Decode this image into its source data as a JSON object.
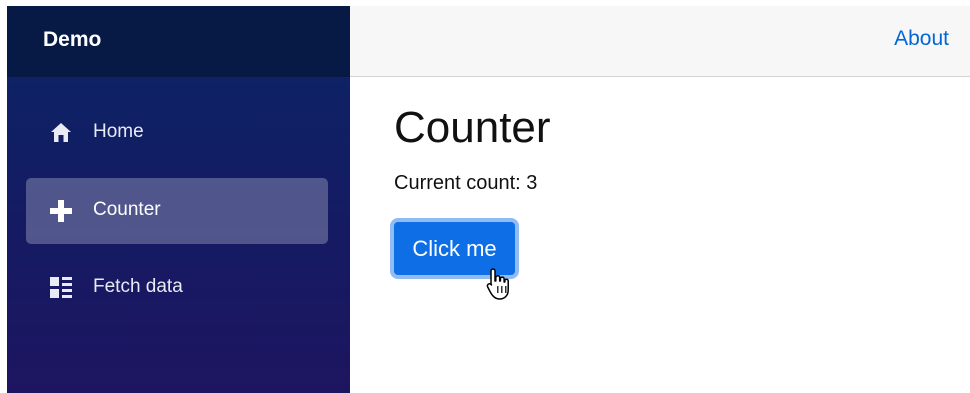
{
  "sidebar": {
    "brand": "Demo",
    "items": [
      {
        "label": "Home",
        "icon": "home-icon",
        "active": false
      },
      {
        "label": "Counter",
        "icon": "plus-icon",
        "active": true
      },
      {
        "label": "Fetch data",
        "icon": "list-rich-icon",
        "active": false
      }
    ]
  },
  "header": {
    "about_label": "About"
  },
  "main": {
    "title": "Counter",
    "count_text": "Current count: 3",
    "button_label": "Click me"
  },
  "colors": {
    "accent": "#0d6ee5",
    "link": "#0366d6",
    "sidebar_top": "#0b2566",
    "sidebar_bottom": "#1e1560"
  }
}
